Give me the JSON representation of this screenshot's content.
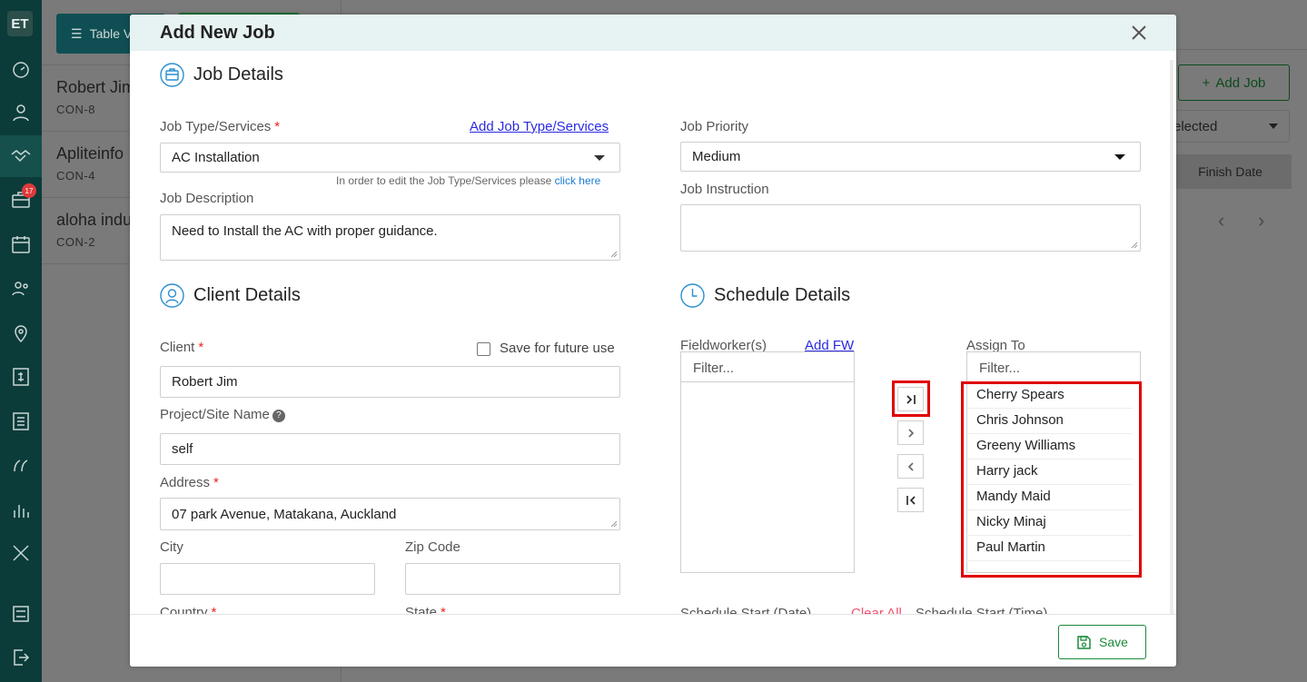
{
  "app": {
    "logo": "ET",
    "notification_count": "17"
  },
  "background": {
    "table_view_label": "Table V",
    "list": [
      {
        "name": "Robert Jim",
        "code": "CON-8"
      },
      {
        "name": "Apliteinfo",
        "code": "CON-4"
      },
      {
        "name": "aloha indu",
        "code": "CON-2"
      }
    ],
    "add_job_label": "Add Job",
    "select_value": "elected",
    "finish_date_header": "Finish Date"
  },
  "modal": {
    "title": "Add New Job",
    "save_label": "Save",
    "job_details": {
      "heading": "Job Details",
      "job_type_label": "Job Type/Services",
      "add_job_type_link": "Add Job Type/Services",
      "job_type_value": "AC Installation",
      "job_type_hint": "In order to edit the Job Type/Services please",
      "job_type_hint_link": "click here",
      "job_description_label": "Job Description",
      "job_description_value": "Need to Install the AC with proper guidance.",
      "job_priority_label": "Job Priority",
      "job_priority_value": "Medium",
      "job_instruction_label": "Job Instruction",
      "job_instruction_value": ""
    },
    "client_details": {
      "heading": "Client Details",
      "client_label": "Client",
      "save_future_label": "Save for future use",
      "client_value": "Robert Jim",
      "project_label": "Project/Site Name",
      "project_value": "self",
      "address_label": "Address",
      "address_value": "07 park Avenue, Matakana, Auckland",
      "city_label": "City",
      "city_value": "",
      "zip_label": "Zip Code",
      "zip_value": "",
      "country_label": "Country",
      "state_label": "State"
    },
    "schedule_details": {
      "heading": "Schedule Details",
      "fieldworkers_label": "Fieldworker(s)",
      "add_fw_link": "Add FW",
      "assign_to_label": "Assign To",
      "filter_placeholder": "Filter...",
      "assign_list": [
        "Cherry Spears",
        "Chris Johnson",
        "Greeny Williams",
        "Harry jack",
        "Mandy Maid",
        "Nicky Minaj",
        "Paul Martin"
      ],
      "schedule_start_date_label": "Schedule Start (Date)",
      "clear_all_label": "Clear All",
      "schedule_start_time_label": "Schedule Start (Time)"
    }
  },
  "colors": {
    "brand_dark": "#0b3c39",
    "accent_green": "#1a8a3a",
    "link_blue": "#2a2ae0",
    "highlight_red": "#e00000",
    "clear_pink": "#f0506e"
  }
}
